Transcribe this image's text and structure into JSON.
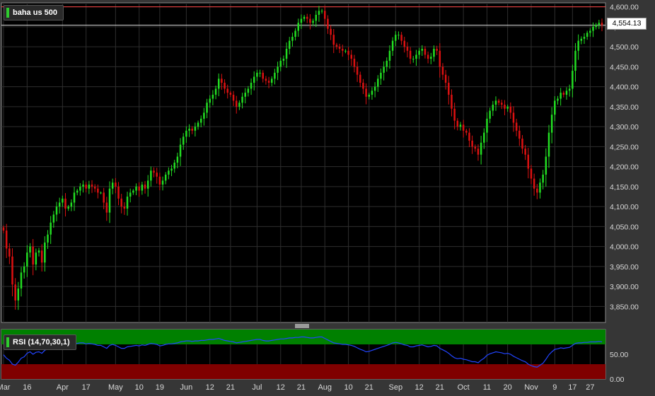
{
  "instrument": {
    "name": "baha us 500",
    "last_price_label": "4,554.13",
    "last_price": 4554.13
  },
  "indicator": {
    "label": "RSI (14,70,30,1)"
  },
  "colors": {
    "up": "#22dd22",
    "down": "#dd1111",
    "rsi_line": "#2244ff",
    "overbought": "#008000",
    "oversold": "#800000"
  },
  "chart_data": [
    {
      "type": "candlestick",
      "ylim": [
        3810,
        4610
      ],
      "y_ticks": [
        {
          "value": 3850,
          "label": "3,850.00"
        },
        {
          "value": 3900,
          "label": "3,900.00"
        },
        {
          "value": 3950,
          "label": "3,950.00"
        },
        {
          "value": 4000,
          "label": "4,000.00"
        },
        {
          "value": 4050,
          "label": "4,050.00"
        },
        {
          "value": 4100,
          "label": "4,100.00"
        },
        {
          "value": 4150,
          "label": "4,150.00"
        },
        {
          "value": 4200,
          "label": "4,200.00"
        },
        {
          "value": 4250,
          "label": "4,250.00"
        },
        {
          "value": 4300,
          "label": "4,300.00"
        },
        {
          "value": 4350,
          "label": "4,350.00"
        },
        {
          "value": 4400,
          "label": "4,400.00"
        },
        {
          "value": 4450,
          "label": "4,450.00"
        },
        {
          "value": 4500,
          "label": "4,500.00"
        },
        {
          "value": 4550,
          "label": "4,550.00"
        },
        {
          "value": 4600,
          "label": "4,600.00"
        }
      ],
      "x_ticks": [
        {
          "index": 0,
          "label": "Mar"
        },
        {
          "index": 8,
          "label": "16"
        },
        {
          "index": 20,
          "label": "Apr"
        },
        {
          "index": 28,
          "label": "17"
        },
        {
          "index": 38,
          "label": "May"
        },
        {
          "index": 46,
          "label": "10"
        },
        {
          "index": 53,
          "label": "19"
        },
        {
          "index": 62,
          "label": "Jun"
        },
        {
          "index": 70,
          "label": "12"
        },
        {
          "index": 77,
          "label": "21"
        },
        {
          "index": 86,
          "label": "Jul"
        },
        {
          "index": 94,
          "label": "12"
        },
        {
          "index": 101,
          "label": "21"
        },
        {
          "index": 109,
          "label": "Aug"
        },
        {
          "index": 117,
          "label": "10"
        },
        {
          "index": 124,
          "label": "21"
        },
        {
          "index": 133,
          "label": "Sep"
        },
        {
          "index": 141,
          "label": "12"
        },
        {
          "index": 148,
          "label": "21"
        },
        {
          "index": 156,
          "label": "Oct"
        },
        {
          "index": 164,
          "label": "11"
        },
        {
          "index": 171,
          "label": "20"
        },
        {
          "index": 179,
          "label": "Nov"
        },
        {
          "index": 187,
          "label": "9"
        },
        {
          "index": 193,
          "label": "17"
        },
        {
          "index": 199,
          "label": "27"
        }
      ],
      "horizontal_lines": [
        {
          "value": 4600,
          "color": "#ff4444"
        },
        {
          "value": 4554.13,
          "color": "#dddddd"
        }
      ],
      "close": [
        4040,
        3995,
        3975,
        3905,
        3865,
        3895,
        3935,
        3950,
        3985,
        4000,
        3955,
        3985,
        3990,
        3960,
        4010,
        4030,
        4060,
        4080,
        4100,
        4110,
        4120,
        4095,
        4100,
        4110,
        4135,
        4140,
        4150,
        4155,
        4145,
        4155,
        4150,
        4145,
        4135,
        4135,
        4110,
        4085,
        4145,
        4160,
        4150,
        4120,
        4100,
        4095,
        4125,
        4135,
        4140,
        4150,
        4140,
        4155,
        4145,
        4165,
        4190,
        4185,
        4175,
        4155,
        4165,
        4180,
        4190,
        4195,
        4210,
        4225,
        4255,
        4275,
        4290,
        4295,
        4290,
        4300,
        4310,
        4320,
        4335,
        4360,
        4370,
        4380,
        4395,
        4420,
        4410,
        4395,
        4385,
        4380,
        4365,
        4350,
        4360,
        4375,
        4385,
        4395,
        4410,
        4425,
        4435,
        4435,
        4420,
        4415,
        4410,
        4420,
        4435,
        4450,
        4465,
        4470,
        4495,
        4515,
        4525,
        4540,
        4560,
        4570,
        4575,
        4570,
        4560,
        4565,
        4580,
        4590,
        4590,
        4570,
        4545,
        4530,
        4505,
        4500,
        4495,
        4490,
        4490,
        4480,
        4470,
        4450,
        4430,
        4410,
        4395,
        4375,
        4380,
        4390,
        4400,
        4420,
        4435,
        4450,
        4465,
        4490,
        4515,
        4530,
        4530,
        4515,
        4500,
        4490,
        4470,
        4470,
        4480,
        4490,
        4495,
        4480,
        4470,
        4475,
        4495,
        4490,
        4450,
        4430,
        4410,
        4380,
        4345,
        4315,
        4300,
        4305,
        4290,
        4285,
        4265,
        4250,
        4245,
        4230,
        4260,
        4285,
        4320,
        4340,
        4355,
        4365,
        4360,
        4355,
        4345,
        4350,
        4335,
        4310,
        4290,
        4270,
        4245,
        4230,
        4195,
        4170,
        4145,
        4135,
        4160,
        4180,
        4225,
        4285,
        4330,
        4365,
        4370,
        4385,
        4380,
        4390,
        4395,
        4440,
        4490,
        4515,
        4520,
        4525,
        4535,
        4540,
        4550,
        4555,
        4560,
        4554.13
      ],
      "rsi": {
        "ylim": [
          0,
          100
        ],
        "y_ticks": [
          {
            "value": 0,
            "label": "0.00"
          },
          {
            "value": 50,
            "label": "50.00"
          }
        ],
        "overbought": 70,
        "oversold": 30,
        "values": [
          49,
          42,
          38,
          30,
          28,
          34,
          42,
          45,
          52,
          55,
          50,
          54,
          55,
          52,
          58,
          61,
          65,
          68,
          70,
          71,
          72,
          68,
          69,
          70,
          72,
          72,
          73,
          73,
          71,
          72,
          71,
          70,
          68,
          68,
          65,
          62,
          68,
          70,
          68,
          65,
          62,
          62,
          65,
          66,
          67,
          68,
          67,
          69,
          68,
          70,
          72,
          71,
          70,
          67,
          68,
          70,
          71,
          71,
          72,
          73,
          75,
          76,
          77,
          77,
          76,
          77,
          77,
          78,
          78,
          79,
          80,
          80,
          81,
          82,
          80,
          78,
          77,
          76,
          75,
          73,
          74,
          75,
          76,
          77,
          78,
          79,
          80,
          80,
          78,
          77,
          77,
          78,
          79,
          80,
          81,
          81,
          82,
          83,
          83,
          84,
          84,
          85,
          85,
          84,
          83,
          83,
          84,
          85,
          85,
          82,
          79,
          76,
          73,
          72,
          71,
          70,
          70,
          69,
          68,
          66,
          63,
          60,
          58,
          55,
          56,
          58,
          60,
          62,
          64,
          66,
          68,
          70,
          73,
          74,
          73,
          71,
          69,
          68,
          65,
          65,
          67,
          68,
          69,
          67,
          65,
          66,
          68,
          67,
          62,
          59,
          56,
          52,
          47,
          43,
          41,
          42,
          40,
          39,
          37,
          35,
          35,
          33,
          38,
          42,
          48,
          51,
          53,
          55,
          54,
          53,
          51,
          52,
          50,
          46,
          43,
          40,
          37,
          35,
          30,
          27,
          25,
          24,
          28,
          32,
          40,
          49,
          55,
          60,
          61,
          63,
          62,
          63,
          64,
          68,
          72,
          73,
          73,
          74,
          74,
          75,
          75,
          75,
          76,
          75
        ]
      }
    }
  ]
}
